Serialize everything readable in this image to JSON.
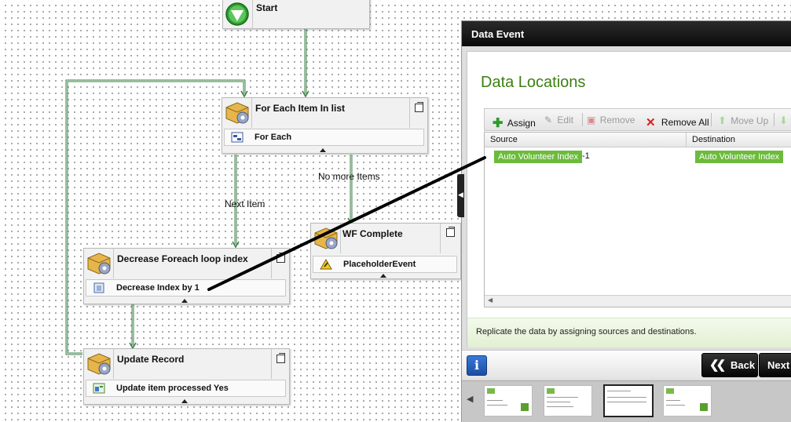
{
  "canvas": {
    "nodes": {
      "start": {
        "title": "Start"
      },
      "for_each": {
        "title": "For Each Item In list",
        "sub": "For Each"
      },
      "wf_complete": {
        "title": "WF Complete",
        "sub": "PlaceholderEvent"
      },
      "decrease": {
        "title": "Decrease Foreach loop index",
        "sub": "Decrease Index by 1"
      },
      "update": {
        "title": "Update Record",
        "sub": "Update item processed Yes"
      }
    },
    "edges": {
      "next_item": "Next Item",
      "no_more_items": "No more Items"
    }
  },
  "dialog": {
    "title": "Data Event",
    "section_title": "Data Locations",
    "toolbar": {
      "assign": "Assign",
      "edit": "Edit",
      "remove": "Remove",
      "remove_all": "Remove All",
      "move_up": "Move Up"
    },
    "grid": {
      "columns": [
        "Source",
        "Destination"
      ],
      "rows": [
        {
          "source": "Auto Volunteer Index",
          "source_suffix": "-1",
          "destination": "Auto Volunteer Index"
        }
      ]
    },
    "hint": "Replicate the data by assigning sources and destinations.",
    "nav": {
      "back": "Back",
      "next": "Next"
    }
  },
  "colors": {
    "accent_green": "#6cbb3c",
    "title_green": "#3d7f12",
    "connector": "#3e7f4a"
  }
}
